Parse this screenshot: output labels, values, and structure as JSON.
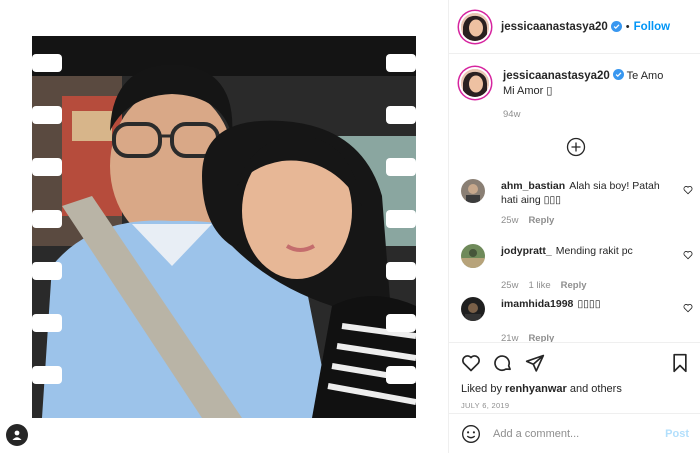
{
  "post": {
    "username": "jessicaanastasya20",
    "verified": true,
    "follow_label": "Follow",
    "caption_text": "Te Amo Mi Amor ▯",
    "caption_time": "94w",
    "liked_by_prefix": "Liked by",
    "liked_by_user": "renhyanwar",
    "liked_by_suffix": "and others",
    "date": "JULY 6, 2019"
  },
  "comments": [
    {
      "user": "ahm_bastian",
      "text": "Alah sia boy! Patah hati aing ▯▯▯",
      "time": "25w",
      "likes": "",
      "reply_label": "Reply"
    },
    {
      "user": "jodypratt_",
      "text": "Mending rakit pc",
      "time": "25w",
      "likes": "1 like",
      "reply_label": "Reply"
    },
    {
      "user": "imamhida1998",
      "text": "▯▯▯▯",
      "time": "21w",
      "likes": "",
      "reply_label": "Reply"
    }
  ],
  "composer": {
    "placeholder": "Add a comment...",
    "post_label": "Post"
  },
  "icons": [
    "more-comments-plus-icon",
    "heart-icon",
    "comment-icon",
    "share-icon",
    "bookmark-icon",
    "emoji-icon",
    "verified-badge-icon",
    "profile-badge-icon"
  ],
  "colors": {
    "accent": "#0095f6",
    "muted": "#8e8e8e",
    "text": "#262626",
    "post_disabled": "#b2dffc"
  }
}
